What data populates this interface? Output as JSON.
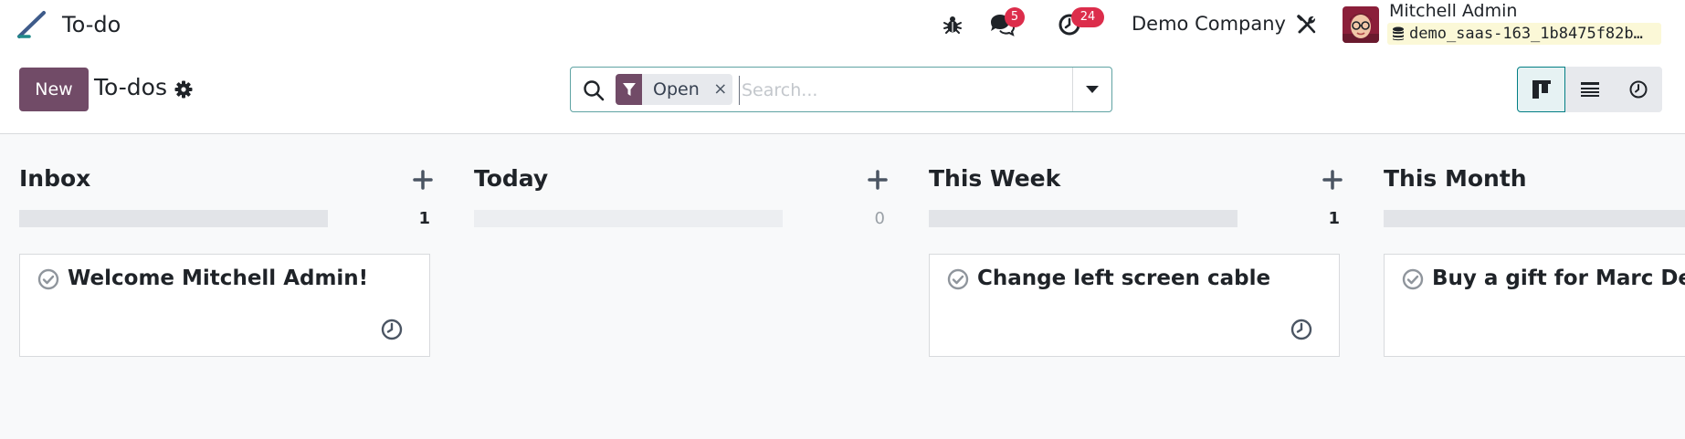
{
  "app": {
    "name": "To-do"
  },
  "navbar": {
    "messages_badge": "5",
    "activities_badge": "24",
    "company": "Demo Company",
    "user_name": "Mitchell Admin",
    "database": "demo_saas-163_1b8475f82b…"
  },
  "control_panel": {
    "new_label": "New",
    "title": "To-dos",
    "search": {
      "facet": "Open",
      "remove": "×",
      "placeholder": "Search..."
    }
  },
  "columns": [
    {
      "title": "Inbox",
      "count": "1",
      "add": "+",
      "cards": [
        {
          "title": "Welcome Mitchell Admin!"
        }
      ]
    },
    {
      "title": "Today",
      "count": "0",
      "add": "+",
      "cards": []
    },
    {
      "title": "This Week",
      "count": "1",
      "add": "+",
      "cards": [
        {
          "title": "Change left screen cable"
        }
      ]
    },
    {
      "title": "This Month",
      "count": "",
      "add": "+",
      "cards": [
        {
          "title": "Buy a gift for Marc Demo's"
        }
      ]
    }
  ],
  "colors": {
    "brand": "#714b67",
    "badge": "#dc2d4b",
    "active_view": "#017e84",
    "db_chip": "#fbf8d7"
  },
  "icons": {
    "app": "pencil-icon",
    "debug": "bug-icon",
    "messages": "chat-bubbles-icon",
    "activities": "clock-icon",
    "settings": "wrench-screwdriver-icon",
    "database": "database-icon",
    "search": "magnifier-icon",
    "filter": "funnel-icon",
    "kanban": "kanban-icon",
    "list": "list-icon",
    "activity_view": "clock-icon"
  }
}
